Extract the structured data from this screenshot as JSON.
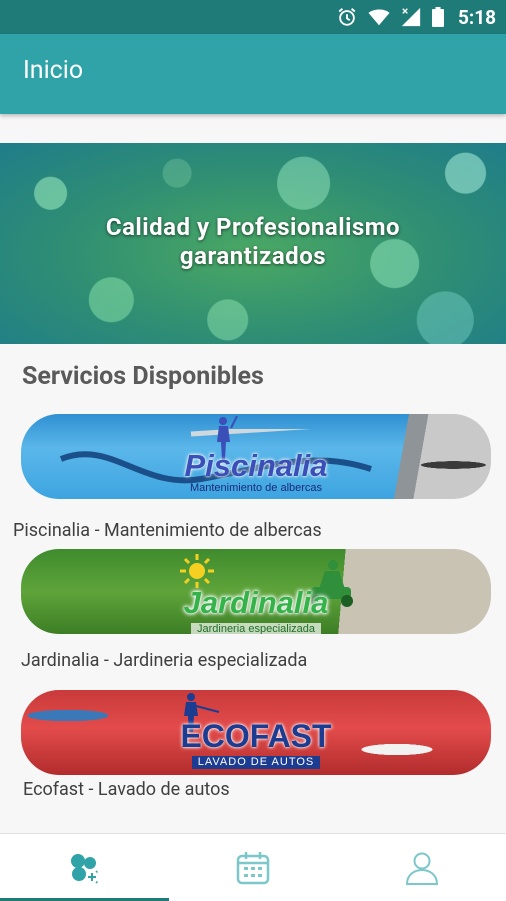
{
  "status_bar": {
    "time": "5:18",
    "icons": [
      "alarm-icon",
      "wifi-icon",
      "signal-icon",
      "battery-icon"
    ],
    "color": "#1f7b78"
  },
  "app_bar": {
    "title": "Inicio",
    "color": "#2fa3a8"
  },
  "hero": {
    "line1": "Calidad y Profesionalismo",
    "line2": "garantizados"
  },
  "section": {
    "title": "Servicios Disponibles"
  },
  "services": [
    {
      "brand": "Piscinalia",
      "brand_subtitle": "Mantenimiento de albercas",
      "caption": "Piscinalia - Mantenimiento de albercas"
    },
    {
      "brand": "Jardinalia",
      "brand_subtitle": "Jardineria especializada",
      "caption": "Jardinalia - Jardineria especializada"
    },
    {
      "brand": "ECOFAST",
      "brand_subtitle": "LAVADO DE AUTOS",
      "caption": "Ecofast - Lavado de autos"
    }
  ],
  "bottom_nav": {
    "items": [
      {
        "icon": "services-icon",
        "active": true
      },
      {
        "icon": "calendar-icon",
        "active": false
      },
      {
        "icon": "profile-icon",
        "active": false
      }
    ],
    "accent": "#2fa3a8"
  }
}
